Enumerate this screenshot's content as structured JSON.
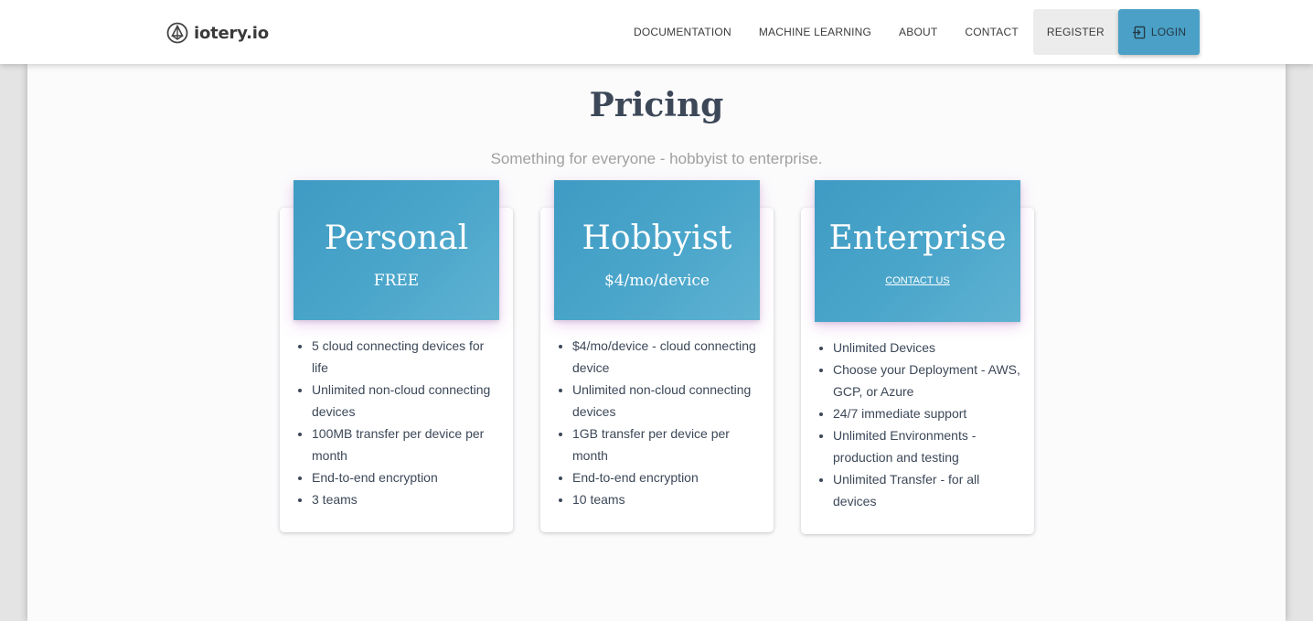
{
  "brand": {
    "name": "iotery.io",
    "icon": "iotery-logo-icon"
  },
  "nav": {
    "links": [
      "DOCUMENTATION",
      "MACHINE LEARNING",
      "ABOUT",
      "CONTACT"
    ],
    "register_label": "REGISTER",
    "login_label": "LOGIN",
    "login_icon": "login-icon",
    "accent_color": "#4aa0c6"
  },
  "page": {
    "title": "Pricing",
    "subtitle": "Something for everyone - hobbyist to enterprise."
  },
  "plans": [
    {
      "name": "Personal",
      "price": "FREE",
      "features": [
        "5 cloud connecting devices for life",
        "Unlimited non-cloud connecting devices",
        "100MB transfer per device per month",
        "End-to-end encryption",
        "3 teams"
      ]
    },
    {
      "name": "Hobbyist",
      "price": "$4/mo/device",
      "features": [
        "$4/mo/device - cloud connecting device",
        "Unlimited non-cloud connecting devices",
        "1GB transfer per device per month",
        "End-to-end encryption",
        "10 teams"
      ]
    },
    {
      "name": "Enterprise",
      "contact_label": "CONTACT US",
      "features": [
        "Unlimited Devices",
        "Choose your Deployment - AWS, GCP, or Azure",
        "24/7 immediate support",
        "Unlimited Environments - production and testing",
        "Unlimited Transfer - for all devices"
      ]
    }
  ]
}
